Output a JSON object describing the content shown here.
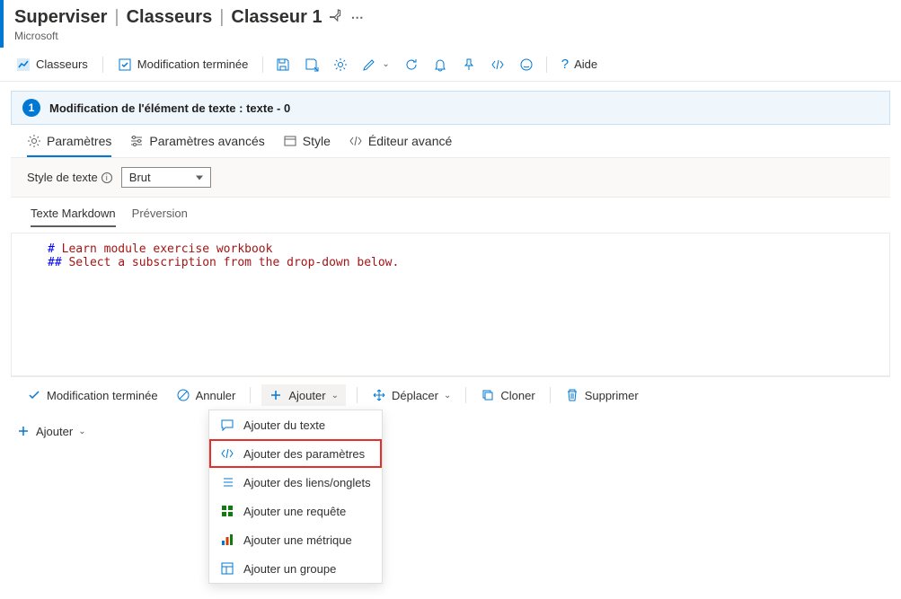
{
  "header": {
    "crumb1": "Superviser",
    "crumb2": "Classeurs",
    "crumb3": "Classeur 1",
    "subtitle": "Microsoft"
  },
  "toolbar": {
    "workbooks": "Classeurs",
    "done_editing": "Modification terminée",
    "help": "Aide"
  },
  "edit_header": {
    "step": "1",
    "title": "Modification de l'élément de texte : texte - 0"
  },
  "tabs": {
    "params": "Paramètres",
    "adv_params": "Paramètres avancés",
    "style": "Style",
    "adv_editor": "Éditeur avancé"
  },
  "form": {
    "style_label": "Style de texte",
    "style_value": "Brut"
  },
  "inner_tabs": {
    "markdown": "Texte Markdown",
    "preview": "Préversion"
  },
  "editor": {
    "line1_kw": "# ",
    "line1_txt": "Learn module exercise workbook",
    "line2_kw": "## ",
    "line2_txt": "Select a subscription from the drop-down below."
  },
  "footer": {
    "done": "Modification terminée",
    "cancel": "Annuler",
    "add": "Ajouter",
    "move": "Déplacer",
    "clone": "Cloner",
    "delete": "Supprimer"
  },
  "add_menu": {
    "text": "Ajouter du texte",
    "params": "Ajouter des paramètres",
    "links": "Ajouter des liens/onglets",
    "query": "Ajouter une requête",
    "metric": "Ajouter une métrique",
    "group": "Ajouter un groupe"
  },
  "page_add": "Ajouter"
}
